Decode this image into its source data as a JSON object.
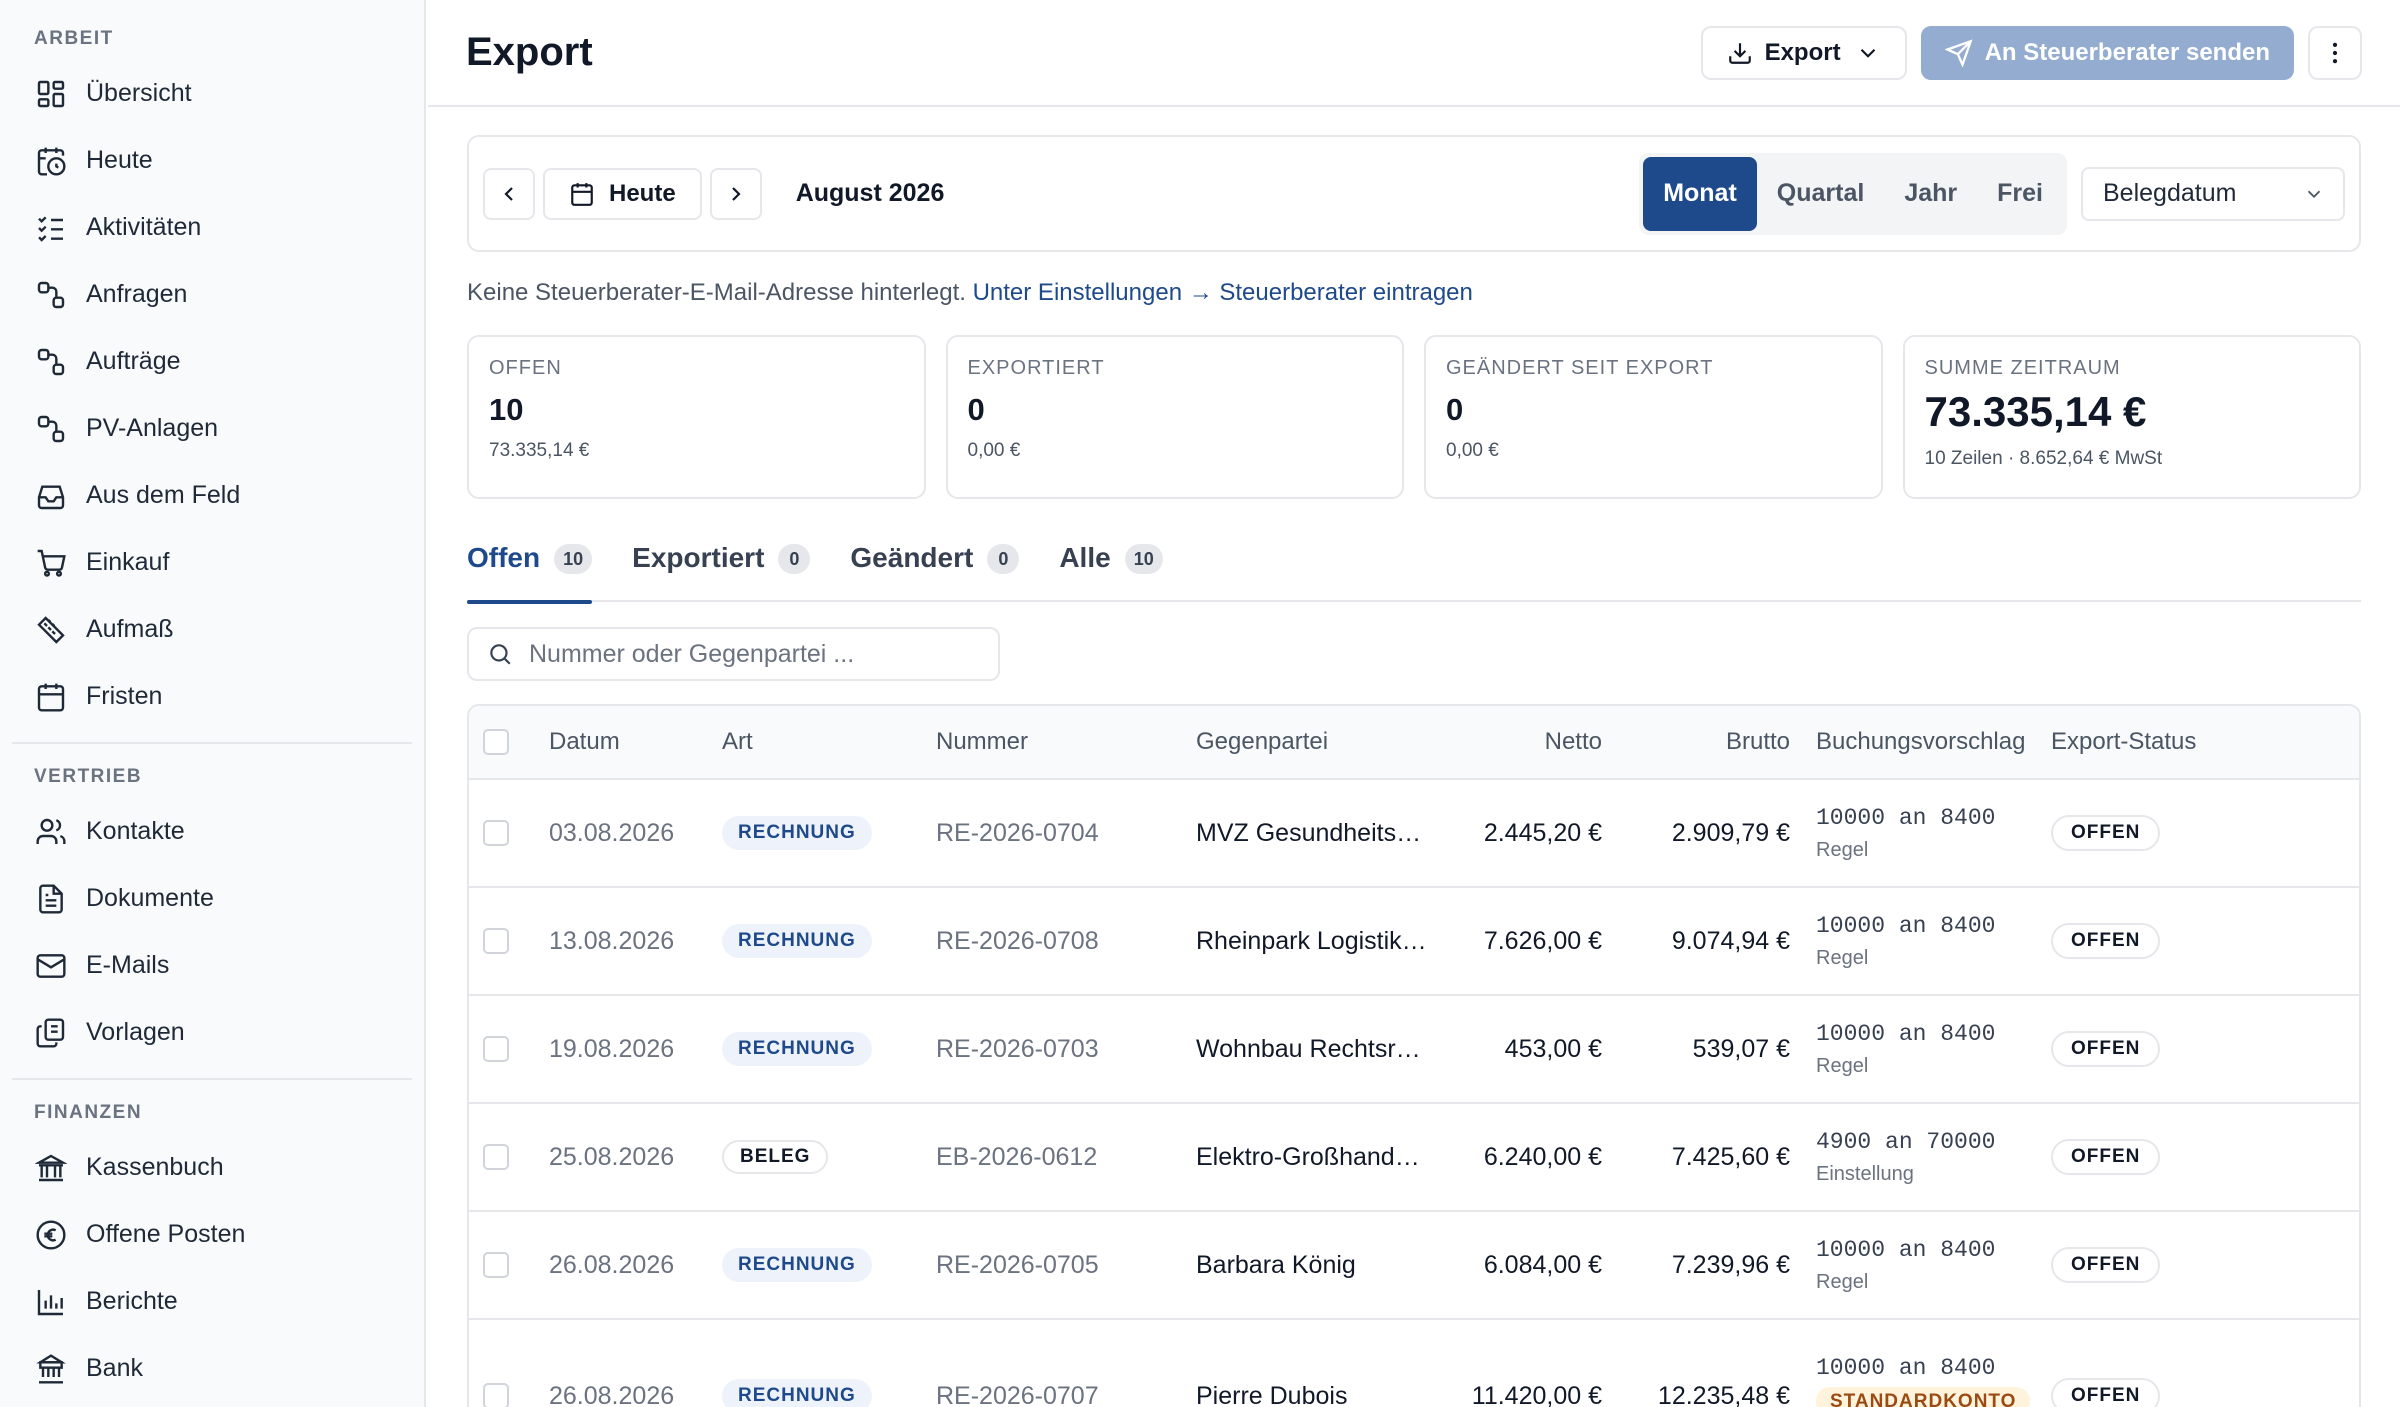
{
  "sidebar": {
    "sections": [
      {
        "heading": "ARBEIT",
        "items": [
          {
            "label": "Übersicht",
            "icon": "dashboard-icon"
          },
          {
            "label": "Heute",
            "icon": "calendar-clock-icon"
          },
          {
            "label": "Aktivitäten",
            "icon": "checklist-icon"
          },
          {
            "label": "Anfragen",
            "icon": "route-icon"
          },
          {
            "label": "Aufträge",
            "icon": "route-icon"
          },
          {
            "label": "PV-Anlagen",
            "icon": "route-icon"
          },
          {
            "label": "Aus dem Feld",
            "icon": "inbox-icon"
          },
          {
            "label": "Einkauf",
            "icon": "cart-icon"
          },
          {
            "label": "Aufmaß",
            "icon": "ruler-icon"
          },
          {
            "label": "Fristen",
            "icon": "calendar-icon"
          }
        ]
      },
      {
        "heading": "VERTRIEB",
        "items": [
          {
            "label": "Kontakte",
            "icon": "users-icon"
          },
          {
            "label": "Dokumente",
            "icon": "document-icon"
          },
          {
            "label": "E-Mails",
            "icon": "mail-icon"
          },
          {
            "label": "Vorlagen",
            "icon": "copy-icon"
          }
        ]
      },
      {
        "heading": "FINANZEN",
        "items": [
          {
            "label": "Kassenbuch",
            "icon": "bank-icon"
          },
          {
            "label": "Offene Posten",
            "icon": "euro-icon"
          },
          {
            "label": "Berichte",
            "icon": "bar-chart-icon"
          },
          {
            "label": "Bank",
            "icon": "bank-building-icon"
          }
        ]
      }
    ]
  },
  "header": {
    "title": "Export",
    "export_label": "Export",
    "send_label": "An Steuerberater senden"
  },
  "period": {
    "today_label": "Heute",
    "current": "August 2026",
    "modes": [
      "Monat",
      "Quartal",
      "Jahr",
      "Frei"
    ],
    "active_mode": "Monat",
    "date_field": "Belegdatum"
  },
  "notice": {
    "text": "Keine Steuerberater-E-Mail-Adresse hinterlegt.",
    "link": "Unter Einstellungen → Steuerberater eintragen"
  },
  "stats": [
    {
      "label": "OFFEN",
      "value": "10",
      "sub": "73.335,14 €"
    },
    {
      "label": "EXPORTIERT",
      "value": "0",
      "sub": "0,00 €"
    },
    {
      "label": "GEÄNDERT SEIT EXPORT",
      "value": "0",
      "sub": "0,00 €"
    },
    {
      "label": "SUMME ZEITRAUM",
      "value": "73.335,14 €",
      "sub": "10 Zeilen · 8.652,64 € MwSt"
    }
  ],
  "tabs": [
    {
      "label": "Offen",
      "count": "10"
    },
    {
      "label": "Exportiert",
      "count": "0"
    },
    {
      "label": "Geändert",
      "count": "0"
    },
    {
      "label": "Alle",
      "count": "10"
    }
  ],
  "search": {
    "placeholder": "Nummer oder Gegenpartei ..."
  },
  "table": {
    "columns": [
      "Datum",
      "Art",
      "Nummer",
      "Gegenpartei",
      "Netto",
      "Brutto",
      "Buchungsvorschlag",
      "Export-Status"
    ],
    "rows": [
      {
        "date": "03.08.2026",
        "type": "RECHNUNG",
        "number": "RE-2026-0704",
        "party": "MVZ Gesundheitsz...",
        "netto": "2.445,20 €",
        "brutto": "2.909,79 €",
        "booking": "10000 an 8400",
        "booking_note": "Regel",
        "status": "OFFEN"
      },
      {
        "date": "13.08.2026",
        "type": "RECHNUNG",
        "number": "RE-2026-0708",
        "party": "Rheinpark Logistik ...",
        "netto": "7.626,00 €",
        "brutto": "9.074,94 €",
        "booking": "10000 an 8400",
        "booking_note": "Regel",
        "status": "OFFEN"
      },
      {
        "date": "19.08.2026",
        "type": "RECHNUNG",
        "number": "RE-2026-0703",
        "party": "Wohnbau Rechtsrh...",
        "netto": "453,00 €",
        "brutto": "539,07 €",
        "booking": "10000 an 8400",
        "booking_note": "Regel",
        "status": "OFFEN"
      },
      {
        "date": "25.08.2026",
        "type": "BELEG",
        "number": "EB-2026-0612",
        "party": "Elektro-Großhande...",
        "netto": "6.240,00 €",
        "brutto": "7.425,60 €",
        "booking": "4900 an 70000",
        "booking_note": "Einstellung",
        "status": "OFFEN"
      },
      {
        "date": "26.08.2026",
        "type": "RECHNUNG",
        "number": "RE-2026-0705",
        "party": "Barbara König",
        "netto": "6.084,00 €",
        "brutto": "7.239,96 €",
        "booking": "10000 an 8400",
        "booking_note": "Regel",
        "status": "OFFEN"
      },
      {
        "date": "26.08.2026",
        "type": "RECHNUNG",
        "number": "RE-2026-0707",
        "party": "Pierre Dubois",
        "netto": "11.420,00 €",
        "brutto": "12.235,48 €",
        "booking": "10000 an 8400",
        "booking_warning": "STANDARDKONTO",
        "status": "OFFEN"
      }
    ]
  },
  "colors": {
    "accent": "#1e4a8c",
    "send_button": "#93acd0",
    "warning_bg": "#fff3dc"
  }
}
